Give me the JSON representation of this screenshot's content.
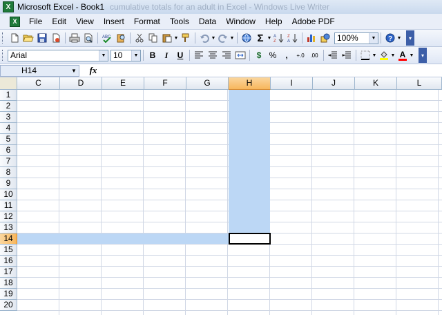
{
  "window": {
    "title": "Microsoft Excel - Book1",
    "behind_title": "cumulative totals for an adult in Excel - Windows Live Writer",
    "app_icon_glyph": "X"
  },
  "menu": {
    "items": [
      "File",
      "Edit",
      "View",
      "Insert",
      "Format",
      "Tools",
      "Data",
      "Window",
      "Help",
      "Adobe PDF"
    ]
  },
  "toolbar_standard": {
    "buttons": [
      "new-icon",
      "open-icon",
      "save-icon",
      "permission-icon",
      "print-icon",
      "print-preview-icon",
      "spelling-icon",
      "research-icon",
      "cut-icon",
      "copy-icon",
      "paste-icon",
      "format-painter-icon",
      "undo-icon",
      "redo-icon",
      "hyperlink-icon",
      "autosum-icon",
      "sort-ascending-icon",
      "sort-descending-icon",
      "chart-wizard-icon",
      "drawing-icon",
      "help-icon"
    ],
    "autosum_glyph": "Σ",
    "zoom": "100%"
  },
  "toolbar_formatting": {
    "font_name": "Arial",
    "font_size": "10",
    "bold_label": "B",
    "italic_label": "I",
    "underline_label": "U",
    "currency_glyph": "$",
    "percent_glyph": "%",
    "comma_glyph": ",",
    "increase_decimal_label": "+.0",
    "decrease_decimal_label": ".00",
    "font_color_label": "A",
    "fill_color": "#ffff00",
    "font_color": "#ff0000"
  },
  "formula_bar": {
    "name_box": "H14",
    "fx_label": "fx",
    "content": ""
  },
  "sheet": {
    "columns": [
      "C",
      "D",
      "E",
      "F",
      "G",
      "H",
      "I",
      "J",
      "K",
      "L"
    ],
    "rows": [
      "1",
      "2",
      "3",
      "4",
      "5",
      "6",
      "7",
      "8",
      "9",
      "10",
      "11",
      "12",
      "13",
      "14",
      "15",
      "16",
      "17",
      "18",
      "19",
      "20"
    ],
    "selected_column": "H",
    "selected_row": "14",
    "highlight_color": "#bcd7f5",
    "header_selected_color": "#f7b65c"
  }
}
